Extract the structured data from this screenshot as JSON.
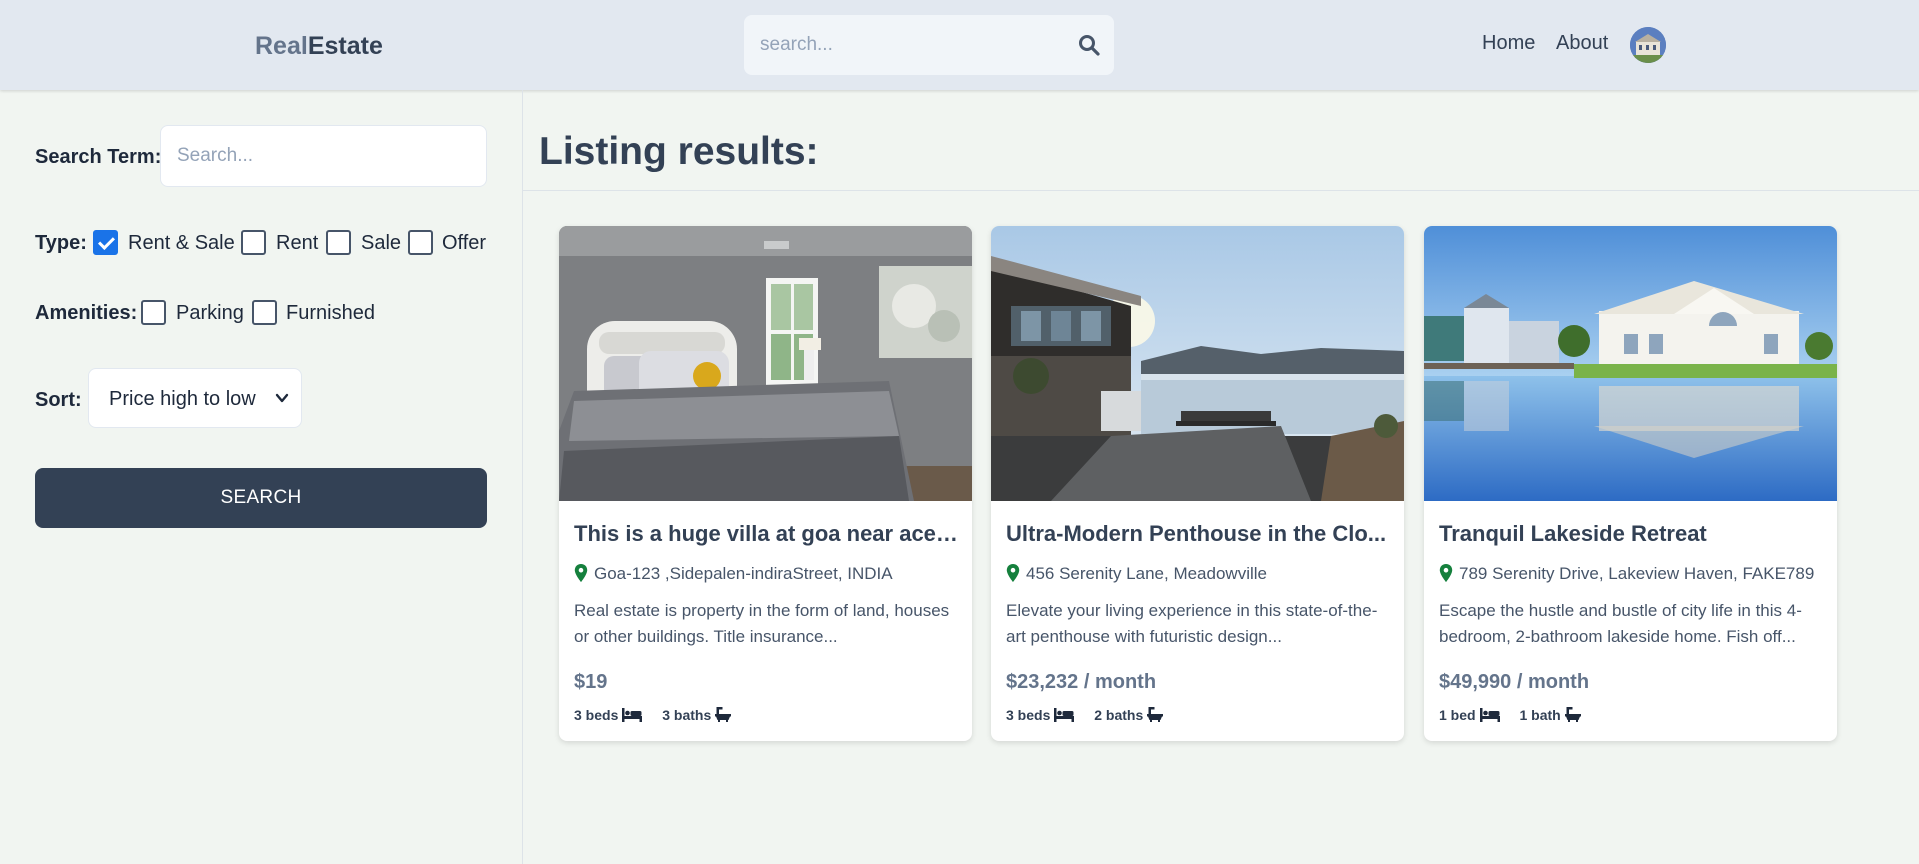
{
  "header": {
    "logo_part1": "Real",
    "logo_part2": "Estate",
    "search_placeholder": "search...",
    "nav": {
      "home": "Home",
      "about": "About"
    }
  },
  "sidebar": {
    "search_term_label": "Search Term:",
    "search_term_placeholder": "Search...",
    "type_label": "Type:",
    "type_options": [
      {
        "label": "Rent & Sale",
        "checked": true
      },
      {
        "label": "Rent",
        "checked": false
      },
      {
        "label": "Sale",
        "checked": false
      },
      {
        "label": "Offer",
        "checked": false
      }
    ],
    "amenities_label": "Amenities:",
    "amenities_options": [
      {
        "label": "Parking",
        "checked": false
      },
      {
        "label": "Furnished",
        "checked": false
      }
    ],
    "sort_label": "Sort:",
    "sort_value": "Price high to low",
    "search_button": "SEARCH"
  },
  "main": {
    "title": "Listing results:",
    "listings": [
      {
        "title": "This is a huge villa at goa near acean",
        "address": "Goa-123 ,Sidepalen-indiraStreet, INDIA",
        "description": "Real estate is property in the form of land, houses or other buildings. Title insurance...",
        "price": "$19",
        "beds": "3 beds",
        "baths": "3 baths"
      },
      {
        "title": "Ultra-Modern Penthouse in the Clo...",
        "address": "456 Serenity Lane, Meadowville",
        "description": "Elevate your living experience in this state-of-the-art penthouse with futuristic design...",
        "price": "$23,232 / month",
        "beds": "3 beds",
        "baths": "2 baths"
      },
      {
        "title": "Tranquil Lakeside Retreat",
        "address": "789 Serenity Drive, Lakeview Haven, FAKE789",
        "description": "Escape the hustle and bustle of city life in this 4-bedroom, 2-bathroom lakeside home. Fish off...",
        "price": "$49,990 / month",
        "beds": "1 bed",
        "baths": "1 bath"
      }
    ]
  },
  "colors": {
    "header_bg": "#e2e8f0",
    "page_bg": "#f1f5f1",
    "button_bg": "#334155",
    "checkbox_checked": "#1a73e8",
    "pin_icon": "#15803d"
  }
}
